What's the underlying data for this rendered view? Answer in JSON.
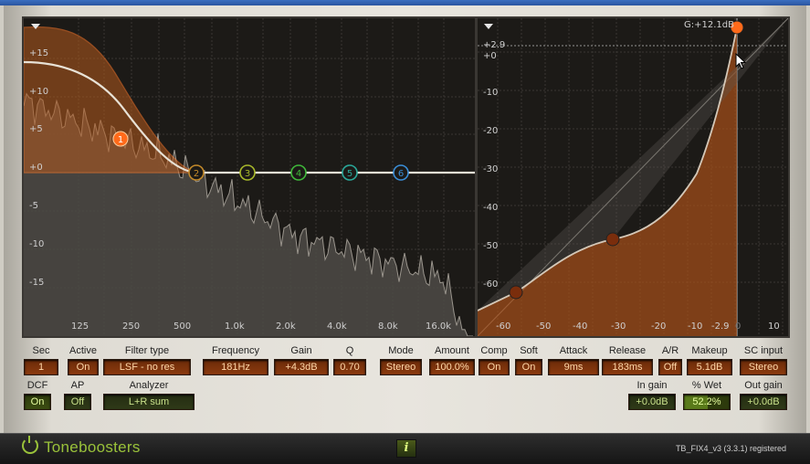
{
  "eq_display": {
    "y_labels": [
      "+15",
      "+10",
      "+5",
      "+0",
      "-5",
      "-10",
      "-15"
    ],
    "x_labels": [
      "125",
      "250",
      "500",
      "1.0k",
      "2.0k",
      "4.0k",
      "8.0k",
      "16.0k"
    ],
    "bands": [
      {
        "label": "1",
        "color": "#ff6a1a",
        "active": true
      },
      {
        "label": "2",
        "color": "#c48a2a"
      },
      {
        "label": "3",
        "color": "#a8b82a"
      },
      {
        "label": "4",
        "color": "#3fb83a"
      },
      {
        "label": "5",
        "color": "#2aa89a"
      },
      {
        "label": "6",
        "color": "#3a8ed8"
      }
    ],
    "menu_icon": "dropdown-triangle-icon"
  },
  "dyn_display": {
    "y_labels": [
      "+2.9",
      "+0",
      "-10",
      "-20",
      "-30",
      "-40",
      "-50",
      "-60"
    ],
    "x_labels": [
      "-60",
      "-50",
      "-40",
      "-30",
      "-20",
      "-10",
      "-2.9",
      "0",
      "10"
    ],
    "gain_readout": "G:+12.1dB",
    "menu_icon": "dropdown-triangle-icon"
  },
  "controls_row1": [
    {
      "id": "sec",
      "label": "Sec",
      "value": "1",
      "style": "orange"
    },
    {
      "id": "active",
      "label": "Active",
      "value": "On",
      "style": "orange"
    },
    {
      "id": "filter_type",
      "label": "Filter type",
      "value": "LSF - no res",
      "style": "orange"
    },
    {
      "id": "frequency",
      "label": "Frequency",
      "value": "181Hz",
      "style": "orange"
    },
    {
      "id": "gain",
      "label": "Gain",
      "value": "+4.3dB",
      "style": "orange"
    },
    {
      "id": "q",
      "label": "Q",
      "value": "0.70",
      "style": "orange"
    },
    {
      "id": "mode",
      "label": "Mode",
      "value": "Stereo",
      "style": "orange"
    },
    {
      "id": "amount",
      "label": "Amount",
      "value": "100.0%",
      "style": "orange"
    },
    {
      "id": "comp",
      "label": "Comp",
      "value": "On",
      "style": "orange"
    },
    {
      "id": "soft",
      "label": "Soft",
      "value": "On",
      "style": "orange"
    },
    {
      "id": "attack",
      "label": "Attack",
      "value": "9ms",
      "style": "orange"
    },
    {
      "id": "release",
      "label": "Release",
      "value": "183ms",
      "style": "orange"
    },
    {
      "id": "ar",
      "label": "A/R",
      "value": "Off",
      "style": "orange"
    },
    {
      "id": "makeup",
      "label": "Makeup",
      "value": "5.1dB",
      "style": "orange"
    },
    {
      "id": "sc_input",
      "label": "SC input",
      "value": "Stereo",
      "style": "orange"
    }
  ],
  "controls_row2": [
    {
      "id": "dcf",
      "label": "DCF",
      "value": "On",
      "style": "green"
    },
    {
      "id": "ap",
      "label": "AP",
      "value": "Off",
      "style": "green-dark"
    },
    {
      "id": "analyzer",
      "label": "Analyzer",
      "value": "L+R sum",
      "style": "green-dark"
    },
    {
      "id": "in_gain",
      "label": "In gain",
      "value": "+0.0dB",
      "style": "green-dark"
    },
    {
      "id": "wet",
      "label": "% Wet",
      "value": "52.2%",
      "style": "green",
      "level": 0.522
    },
    {
      "id": "out_gain",
      "label": "Out gain",
      "value": "+0.0dB",
      "style": "green-dark"
    }
  ],
  "footer": {
    "brand": "Toneboosters",
    "info_label": "i",
    "version": "TB_FIX4_v3 (3.3.1) registered"
  }
}
